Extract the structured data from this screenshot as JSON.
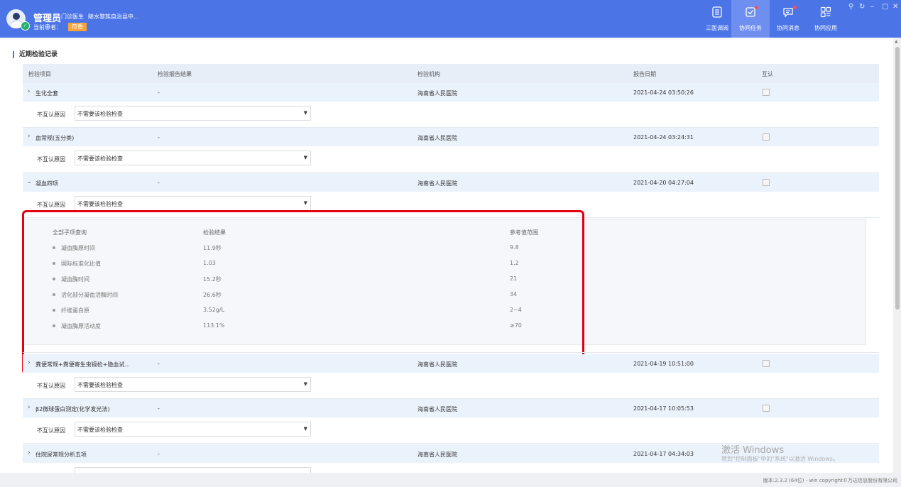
{
  "header": {
    "user_name": "管理员",
    "user_role": "门诊医生",
    "user_org": "陵水黎族自治县中...",
    "patient_label": "当前患者：",
    "patient_name": "符香"
  },
  "nav": [
    {
      "label": "三医调阅",
      "icon": "document-list-icon",
      "active": false
    },
    {
      "label": "协同任务",
      "icon": "task-check-icon",
      "active": true
    },
    {
      "label": "协同消息",
      "icon": "message-icon",
      "active": false
    },
    {
      "label": "协同应用",
      "icon": "apps-grid-icon",
      "active": false
    }
  ],
  "section_title": "近期检验记录",
  "columns": [
    "检验项目",
    "检验报告结果",
    "检验机构",
    "报告日期",
    "互认"
  ],
  "reason_label": "不互认原因",
  "reason_value": "不需要该检验检查",
  "records": [
    {
      "name": "生化全套",
      "result": "-",
      "org": "海南省人民医院",
      "date": "2021-04-24 03:50:26"
    },
    {
      "name": "血常规(五分类)",
      "result": "-",
      "org": "海南省人民医院",
      "date": "2021-04-24 03:24:31"
    },
    {
      "name": "凝血四项",
      "result": "-",
      "org": "海南省人民医院",
      "date": "2021-04-20 04:27:04"
    },
    {
      "name": "粪便常规+粪便寄生虫镜检+隐血试...",
      "result": "-",
      "org": "海南省人民医院",
      "date": "2021-04-19 10:51:00"
    },
    {
      "name": "β2微球蛋白测定(化学发光法)",
      "result": "-",
      "org": "海南省人民医院",
      "date": "2021-04-17 10:05:53"
    },
    {
      "name": "住院尿常规分析五项",
      "result": "-",
      "org": "海南省人民医院",
      "date": "2021-04-17 04:34:03"
    }
  ],
  "sub_header": [
    "全部子项查询",
    "检验结果",
    "参考值范围"
  ],
  "sub_items": [
    {
      "name": "凝血酶原时间",
      "result": "11.9秒",
      "ref": "9.8"
    },
    {
      "name": "国际标准化比值",
      "result": "1.03",
      "ref": "1.2"
    },
    {
      "name": "凝血酶时间",
      "result": "15.2秒",
      "ref": "21"
    },
    {
      "name": "活化部分凝血活酶时间",
      "result": "26.6秒",
      "ref": "34"
    },
    {
      "name": "纤维蛋白原",
      "result": "3.52g/L",
      "ref": "2~4"
    },
    {
      "name": "凝血酶原活动度",
      "result": "113.1%",
      "ref": "≥70"
    }
  ],
  "watermark": {
    "title": "激活 Windows",
    "subtitle": "转到\"控制面板\"中的\"系统\"以激活 Windows。"
  },
  "footer": "版本:2.3.2 (64位) - win   copyright©万达信息股份有限公司",
  "colors": {
    "header_bg": "#4b74e6",
    "row_bg": "#eaf2fb",
    "highlight": "#e3000f",
    "patient_badge": "#f7a53b"
  }
}
